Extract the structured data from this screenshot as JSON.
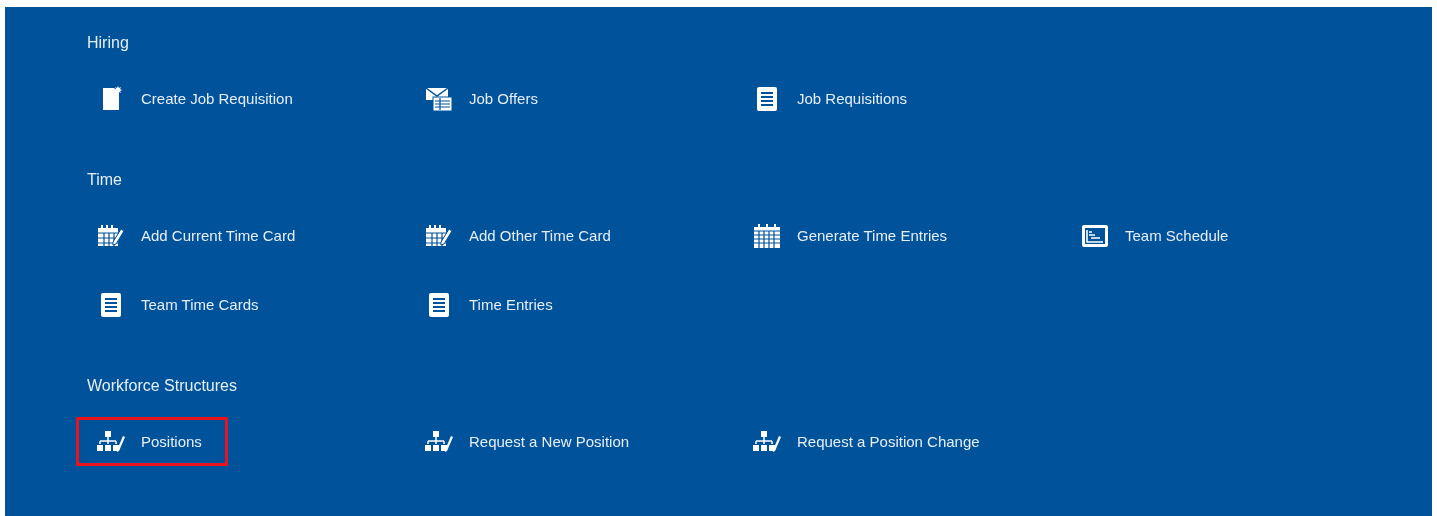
{
  "sections": [
    {
      "title": "Hiring",
      "items": [
        {
          "label": "Create Job Requisition",
          "kind": "create",
          "highlighted": false
        },
        {
          "label": "Job Offers",
          "kind": "offers",
          "highlighted": false
        },
        {
          "label": "Job Requisitions",
          "kind": "list",
          "highlighted": false
        }
      ]
    },
    {
      "title": "Time",
      "items": [
        {
          "label": "Add Current Time Card",
          "kind": "timecard",
          "highlighted": false
        },
        {
          "label": "Add Other Time Card",
          "kind": "timecard",
          "highlighted": false
        },
        {
          "label": "Generate Time Entries",
          "kind": "generate",
          "highlighted": false
        },
        {
          "label": "Team Schedule",
          "kind": "schedule",
          "highlighted": false
        },
        {
          "label": "Team Time Cards",
          "kind": "list",
          "highlighted": false
        },
        {
          "label": "Time Entries",
          "kind": "list",
          "highlighted": false
        }
      ]
    },
    {
      "title": "Workforce Structures",
      "items": [
        {
          "label": "Positions",
          "kind": "position",
          "highlighted": true
        },
        {
          "label": "Request a New Position",
          "kind": "position",
          "highlighted": false
        },
        {
          "label": "Request a Position Change",
          "kind": "position",
          "highlighted": false
        }
      ]
    }
  ]
}
